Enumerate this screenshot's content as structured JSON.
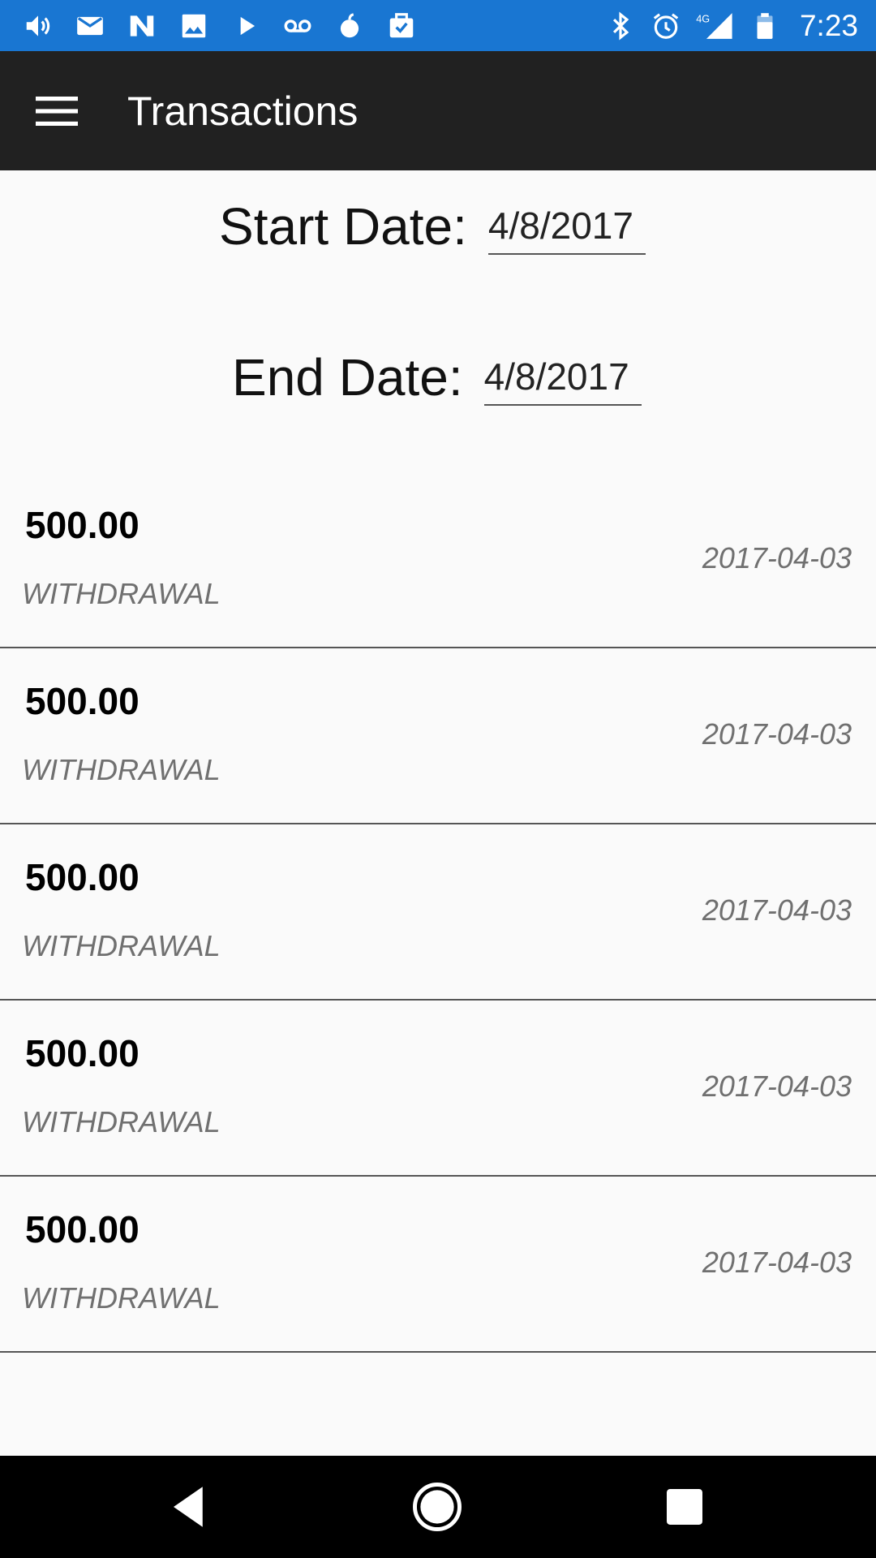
{
  "status_bar": {
    "time": "7:23",
    "network_label": "4G",
    "color": "#1976d2",
    "left_icons": [
      "volume-icon",
      "mail-icon",
      "n-logo-icon",
      "image-icon",
      "play-icon",
      "voicemail-icon",
      "apple-icon",
      "clipboard-icon"
    ],
    "right_icons": [
      "bluetooth-icon",
      "alarm-icon",
      "signal-icon",
      "battery-icon"
    ]
  },
  "app_bar": {
    "title": "Transactions",
    "menu_icon": "menu-icon",
    "color": "#212121"
  },
  "filters": {
    "start_label": "Start Date:",
    "start_value": "4/8/2017",
    "end_label": "End Date:",
    "end_value": "4/8/2017"
  },
  "transactions": [
    {
      "amount": "500.00",
      "type": "WITHDRAWAL",
      "date": "2017-04-03"
    },
    {
      "amount": "500.00",
      "type": "WITHDRAWAL",
      "date": "2017-04-03"
    },
    {
      "amount": "500.00",
      "type": "WITHDRAWAL",
      "date": "2017-04-03"
    },
    {
      "amount": "500.00",
      "type": "WITHDRAWAL",
      "date": "2017-04-03"
    },
    {
      "amount": "500.00",
      "type": "WITHDRAWAL",
      "date": "2017-04-03"
    }
  ],
  "nav_bar": {
    "icons": [
      "back-icon",
      "home-icon",
      "recents-icon"
    ]
  }
}
